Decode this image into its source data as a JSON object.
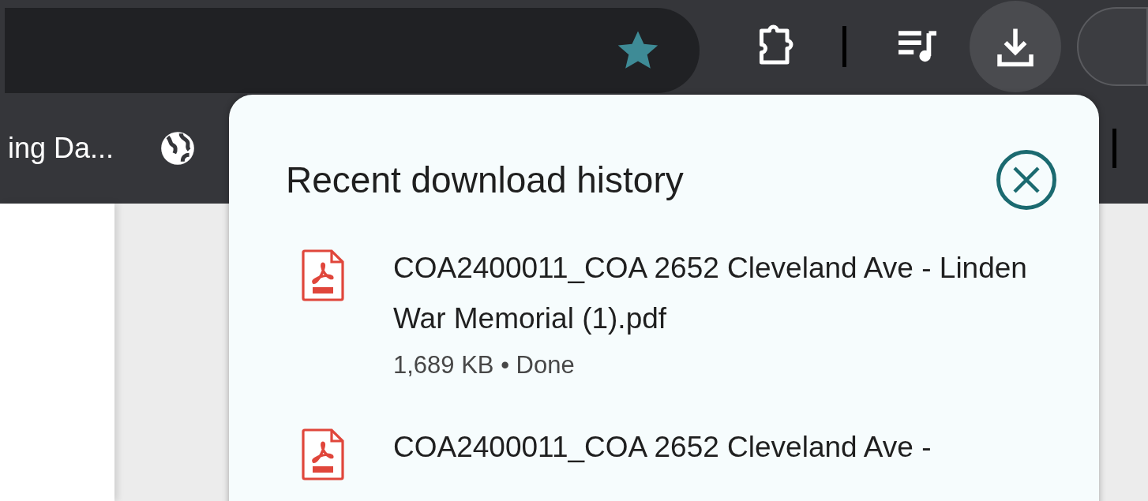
{
  "toolbar": {
    "bookmarked": true
  },
  "bookmarks_bar": {
    "items": [
      {
        "label": "ing Da..."
      }
    ]
  },
  "downloads_popup": {
    "title": "Recent download history",
    "items": [
      {
        "kind": "pdf",
        "name": "COA2400011_COA 2652 Cleveland Ave - Linden War Memorial (1).pdf",
        "status": "1,689 KB • Done"
      },
      {
        "kind": "pdf",
        "name": "COA2400011_COA 2652 Cleveland Ave -"
      }
    ]
  }
}
